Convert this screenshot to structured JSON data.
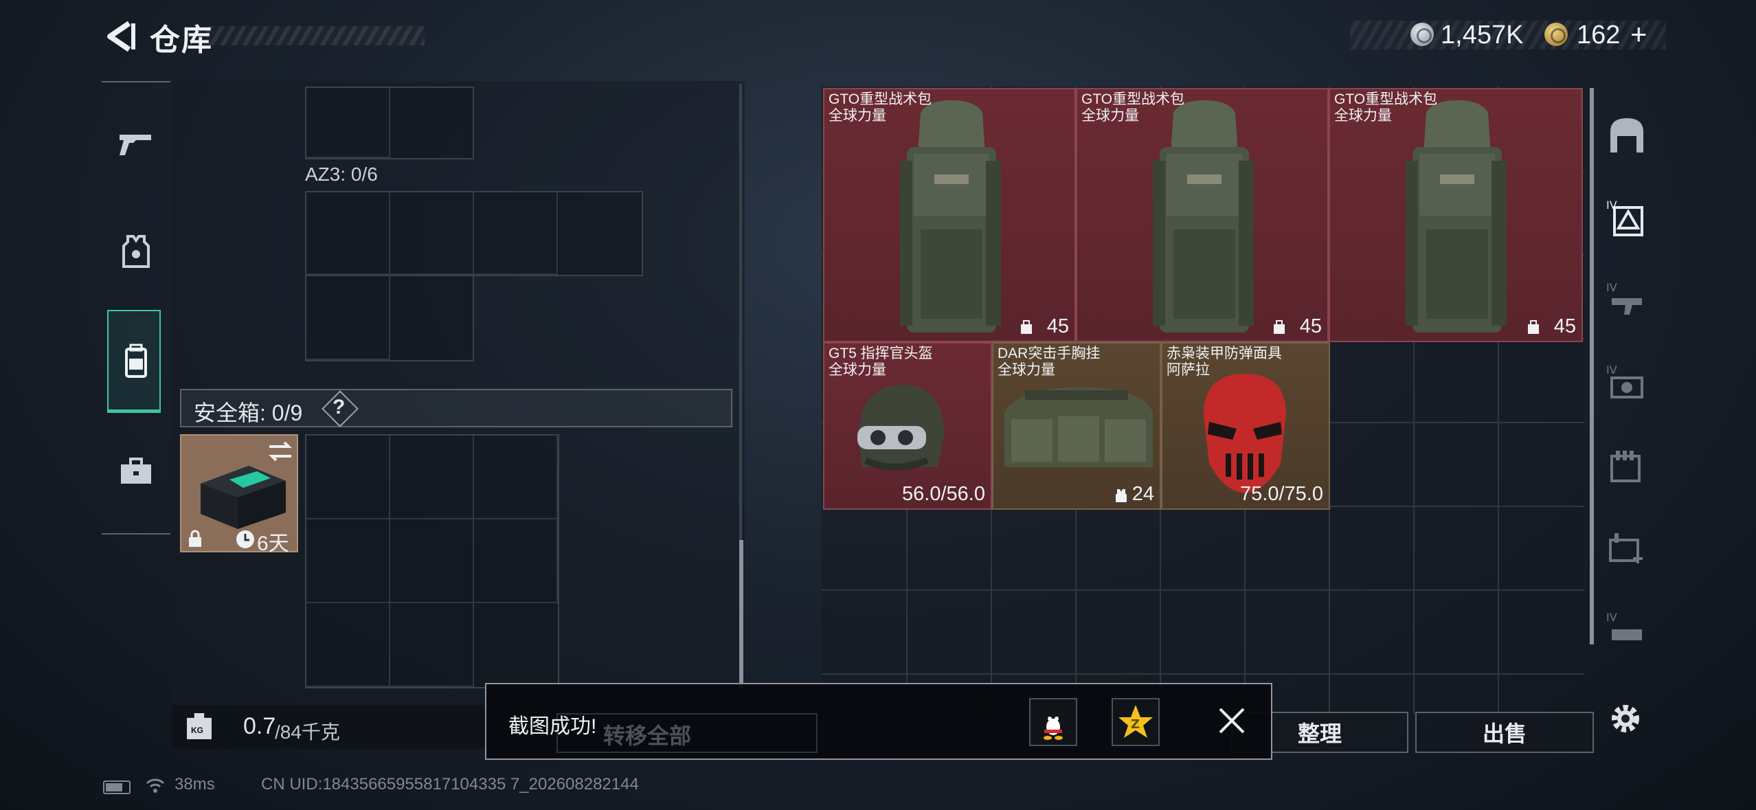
{
  "header": {
    "title": "仓库",
    "currency_silver": "1,457K",
    "currency_gold": "162",
    "plus_label": "+"
  },
  "left_panel": {
    "container_label": "AZ3: 0/6",
    "safe_box_label": "安全箱: 0/9",
    "safe_box_help": "?",
    "safe_box_timer": "6天",
    "weight_current": "0.7",
    "weight_max": "/84千克",
    "weight_icon_text": "KG"
  },
  "items": [
    {
      "name": "GTO重型战术包",
      "sub": "全球力量",
      "value": "45",
      "color": "red"
    },
    {
      "name": "GTO重型战术包",
      "sub": "全球力量",
      "value": "45",
      "color": "red"
    },
    {
      "name": "GTO重型战术包",
      "sub": "全球力量",
      "value": "45",
      "color": "red"
    },
    {
      "name": "GT5 指挥官头盔",
      "sub": "全球力量",
      "value": "56.0/56.0",
      "color": "red"
    },
    {
      "name": "DAR突击手胸挂",
      "sub": "全球力量",
      "value": "24",
      "color": "brown"
    },
    {
      "name": "赤枭装甲防弹面具",
      "sub": "阿萨拉",
      "value": "75.0/75.0",
      "color": "brown"
    }
  ],
  "buttons": {
    "organize": "整理",
    "sell": "出售",
    "transfer_all": "转移全部"
  },
  "toast": {
    "message": "截图成功!"
  },
  "status": {
    "ping": "38ms",
    "uid": "CN UID:18435665955817104335 7_202608282144"
  },
  "colors": {
    "accent": "#3ec4a4",
    "item_red": "#6b2a33",
    "item_brown": "#5a4630"
  }
}
